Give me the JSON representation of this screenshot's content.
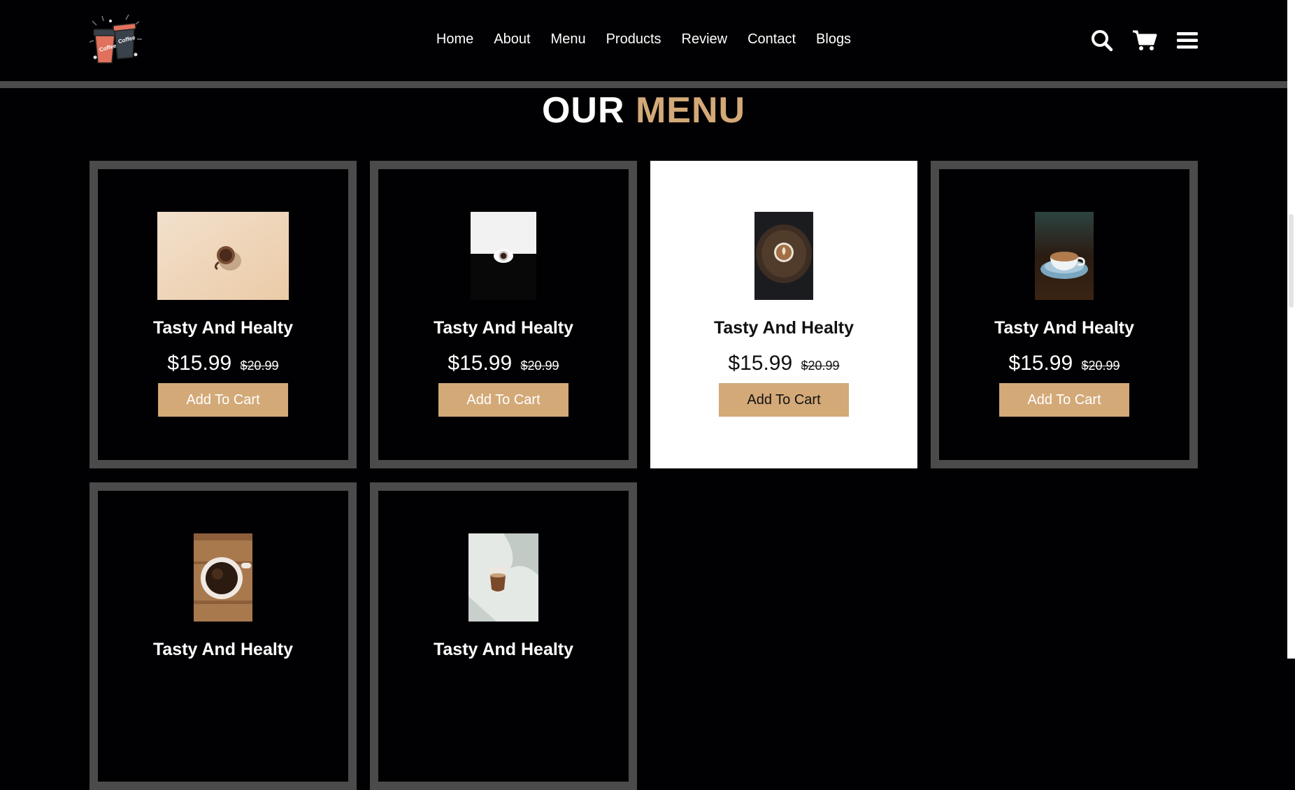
{
  "nav": {
    "links": [
      "Home",
      "About",
      "Menu",
      "Products",
      "Review",
      "Contact",
      "Blogs"
    ]
  },
  "header_icons": [
    "search-icon",
    "cart-icon",
    "menu-bars-icon"
  ],
  "section": {
    "title_main": "OUR",
    "title_accent": "MENU"
  },
  "colors": {
    "accent": "#d3a978",
    "background": "#010103",
    "card_border": "#4b4b4b"
  },
  "products": [
    {
      "name": "Tasty And Healty",
      "price": "$15.99",
      "old_price": "$20.99",
      "button": "Add To Cart",
      "image": "coffee-cup-on-beige"
    },
    {
      "name": "Tasty And Healty",
      "price": "$15.99",
      "old_price": "$20.99",
      "button": "Add To Cart",
      "image": "espresso-black-white"
    },
    {
      "name": "Tasty And Healty",
      "price": "$15.99",
      "old_price": "$20.99",
      "button": "Add To Cart",
      "image": "latte-art-on-wood"
    },
    {
      "name": "Tasty And Healty",
      "price": "$15.99",
      "old_price": "$20.99",
      "button": "Add To Cart",
      "image": "coffee-cup-blue-saucer"
    },
    {
      "name": "Tasty And Healty",
      "image": "black-coffee-on-wood"
    },
    {
      "name": "Tasty And Healty",
      "image": "iced-coffee-glass-shadow"
    }
  ]
}
